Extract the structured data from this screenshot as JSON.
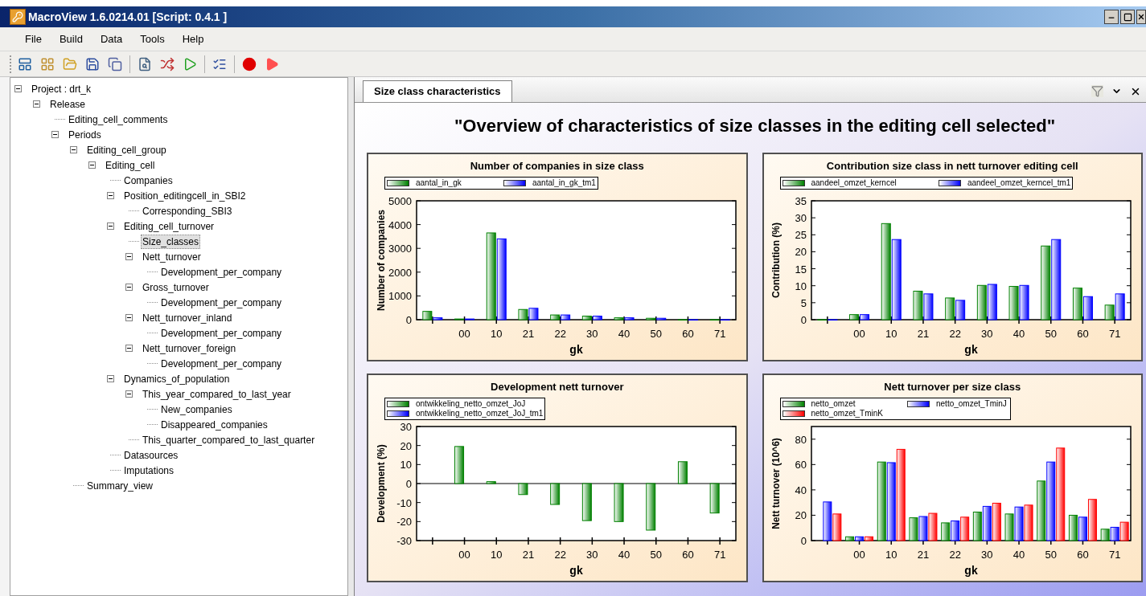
{
  "window": {
    "title": "MacroView 1.6.0214.01 [Script: 0.4.1 ]"
  },
  "menu": [
    "File",
    "Build",
    "Data",
    "Tools",
    "Help"
  ],
  "tree": [
    {
      "label": "Project : drt_k",
      "expanded": true,
      "selected": false,
      "children": [
        {
          "label": "Release",
          "expanded": true,
          "selected": false,
          "children": [
            {
              "label": "Editing_cell_comments",
              "selected": false
            },
            {
              "label": "Periods",
              "expanded": true,
              "selected": false,
              "children": [
                {
                  "label": "Editing_cell_group",
                  "expanded": true,
                  "selected": false,
                  "children": [
                    {
                      "label": "Editing_cell",
                      "expanded": true,
                      "selected": false,
                      "children": [
                        {
                          "label": "Companies",
                          "selected": false
                        },
                        {
                          "label": "Position_editingcell_in_SBI2",
                          "expanded": true,
                          "selected": false,
                          "children": [
                            {
                              "label": "Corresponding_SBI3",
                              "selected": false
                            }
                          ]
                        },
                        {
                          "label": "Editing_cell_turnover",
                          "expanded": true,
                          "selected": false,
                          "children": [
                            {
                              "label": "Size_classes",
                              "selected": true
                            },
                            {
                              "label": "Nett_turnover",
                              "expanded": true,
                              "selected": false,
                              "children": [
                                {
                                  "label": "Development_per_company",
                                  "selected": false
                                }
                              ]
                            },
                            {
                              "label": "Gross_turnover",
                              "expanded": true,
                              "selected": false,
                              "children": [
                                {
                                  "label": "Development_per_company",
                                  "selected": false
                                }
                              ]
                            },
                            {
                              "label": "Nett_turnover_inland",
                              "expanded": true,
                              "selected": false,
                              "children": [
                                {
                                  "label": "Development_per_company",
                                  "selected": false
                                }
                              ]
                            },
                            {
                              "label": "Nett_turnover_foreign",
                              "expanded": true,
                              "selected": false,
                              "children": [
                                {
                                  "label": "Development_per_company",
                                  "selected": false
                                }
                              ]
                            }
                          ]
                        },
                        {
                          "label": "Dynamics_of_population",
                          "expanded": true,
                          "selected": false,
                          "children": [
                            {
                              "label": "This_year_compared_to_last_year",
                              "expanded": true,
                              "selected": false,
                              "children": [
                                {
                                  "label": "New_companies",
                                  "selected": false
                                },
                                {
                                  "label": "Disappeared_companies",
                                  "selected": false
                                }
                              ]
                            },
                            {
                              "label": "This_quarter_compared_to_last_quarter",
                              "selected": false
                            }
                          ]
                        },
                        {
                          "label": "Datasources",
                          "selected": false
                        },
                        {
                          "label": "Imputations",
                          "selected": false
                        }
                      ]
                    }
                  ]
                },
                {
                  "label": "Summary_view",
                  "selected": false
                }
              ]
            }
          ]
        }
      ]
    }
  ],
  "tab": {
    "label": "Size class characteristics",
    "selected": true
  },
  "heading": "\"Overview of characteristics of size classes in the editing cell selected\"",
  "charts": [
    {
      "chart_data": {
        "type": "bar",
        "title": "Number of companies in size class",
        "xlabel": "gk",
        "ylabel": "Number of companies",
        "categories": [
          null,
          "00",
          "10",
          "21",
          "22",
          "30",
          "40",
          "50",
          "60",
          "71"
        ],
        "ylim": [
          0,
          5000
        ],
        "yticks": [
          0,
          1000,
          2000,
          3000,
          4000,
          5000
        ],
        "series": [
          {
            "name": "aantal_in_gk",
            "color": "#008000",
            "values": [
              350,
              30,
              3650,
              430,
              200,
              150,
              80,
              60,
              0,
              0
            ]
          },
          {
            "name": "aantal_in_gk_tm1",
            "color": "#0000ff",
            "values": [
              80,
              30,
              3400,
              480,
              200,
              150,
              80,
              60,
              0,
              0
            ]
          }
        ]
      }
    },
    {
      "chart_data": {
        "type": "bar",
        "title": "Contribution size class in nett turnover editing cell",
        "xlabel": "gk",
        "ylabel": "Contribution (%)",
        "categories": [
          null,
          "00",
          "10",
          "21",
          "22",
          "30",
          "40",
          "50",
          "60",
          "71"
        ],
        "ylim": [
          0,
          35
        ],
        "yticks": [
          0,
          5,
          10,
          15,
          20,
          25,
          30,
          35
        ],
        "series": [
          {
            "name": "aandeel_omzet_kerncel",
            "color": "#008000",
            "values": [
              0,
              1.5,
              28.3,
              8.4,
              6.4,
              10.1,
              9.8,
              21.7,
              9.3,
              4.3
            ]
          },
          {
            "name": "aandeel_omzet_kerncel_tm1",
            "color": "#0000ff",
            "values": [
              0,
              1.5,
              23.6,
              7.6,
              5.7,
              10.4,
              10.1,
              23.6,
              6.8,
              7.6
            ]
          }
        ]
      }
    },
    {
      "chart_data": {
        "type": "bar",
        "title": "Development nett turnover",
        "xlabel": "gk",
        "ylabel": "Development (%)",
        "categories": [
          null,
          "00",
          "10",
          "21",
          "22",
          "30",
          "40",
          "50",
          "60",
          "71"
        ],
        "ylim": [
          -30,
          30
        ],
        "yticks": [
          -30,
          -20,
          -10,
          0,
          10,
          20,
          30
        ],
        "series": [
          {
            "name": "ontwikkeling_netto_omzet_JoJ",
            "color": "#008000",
            "values": [
              null,
              19.5,
              1,
              -5.8,
              -11,
              -19.5,
              -20,
              -24.5,
              11.5,
              -15.5
            ]
          },
          {
            "name": "ontwikkeling_netto_omzet_JoJ_tm1",
            "color": "#0000ff",
            "values": [
              null,
              null,
              null,
              null,
              null,
              null,
              null,
              null,
              null,
              null
            ]
          }
        ]
      }
    },
    {
      "chart_data": {
        "type": "bar",
        "title": "Nett turnover per size class",
        "xlabel": "gk",
        "ylabel": "Nett turnover (10^6)",
        "categories": [
          null,
          "00",
          "10",
          "21",
          "22",
          "30",
          "40",
          "50",
          "60",
          "71"
        ],
        "ylim": [
          0,
          90
        ],
        "yticks": [
          0,
          20,
          40,
          60,
          80
        ],
        "series": [
          {
            "name": "netto_omzet",
            "color": "#008000",
            "values": [
              null,
              3,
              62,
              18,
              14,
              22.5,
              21,
              47,
              20,
              9
            ]
          },
          {
            "name": "netto_omzet_TminJ",
            "color": "#0000ff",
            "values": [
              30.5,
              3,
              61.5,
              19,
              15.5,
              27,
              26.5,
              62,
              18.5,
              10.5
            ]
          },
          {
            "name": "netto_omzet_TminK",
            "color": "#ff0000",
            "values": [
              21,
              3,
              72,
              21.5,
              18.5,
              29.5,
              28,
              73,
              32.5,
              14.5
            ]
          }
        ]
      }
    }
  ]
}
